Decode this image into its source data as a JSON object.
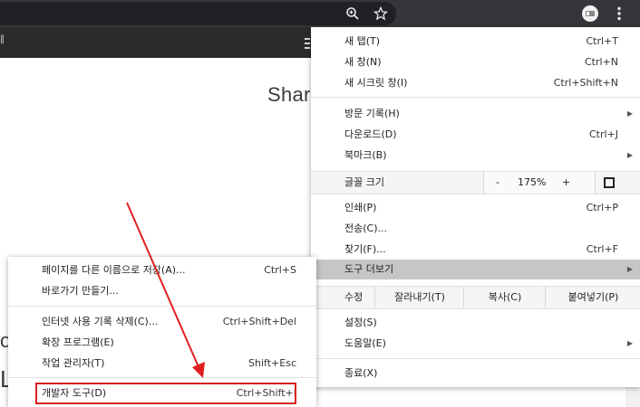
{
  "toolbar": {
    "zoom_icon": "zoom-in-icon",
    "star_icon": "star-icon",
    "extension_icon": "extension-icon",
    "menu_icon": "kebab-menu-icon"
  },
  "page": {
    "heading": "Shar",
    "fragment_1": "o",
    "fragment_2": "Ш",
    "bar_mark": "‖"
  },
  "menu": {
    "new_tab": {
      "label": "새 탭(T)",
      "shortcut": "Ctrl+T"
    },
    "new_window": {
      "label": "새 창(N)",
      "shortcut": "Ctrl+N"
    },
    "incognito": {
      "label": "새 시크릿 창(I)",
      "shortcut": "Ctrl+Shift+N"
    },
    "history": {
      "label": "방문 기록(H)"
    },
    "downloads": {
      "label": "다운로드(D)",
      "shortcut": "Ctrl+J"
    },
    "bookmarks": {
      "label": "북마크(B)"
    },
    "zoom": {
      "label": "글꼴 크기",
      "minus": "-",
      "value": "175%",
      "plus": "+"
    },
    "print": {
      "label": "인쇄(P)",
      "shortcut": "Ctrl+P"
    },
    "cast": {
      "label": "전송(C)..."
    },
    "find": {
      "label": "찾기(F)...",
      "shortcut": "Ctrl+F"
    },
    "more_tools": {
      "label": "도구 더보기"
    },
    "edit": {
      "label": "수정",
      "cut": "잘라내기(T)",
      "copy": "복사(C)",
      "paste": "붙여넣기(P)"
    },
    "settings": {
      "label": "설정(S)"
    },
    "help": {
      "label": "도움말(E)"
    },
    "exit": {
      "label": "종료(X)"
    }
  },
  "submenu": {
    "save_page": {
      "label": "페이지를 다른 이름으로 저장(A)...",
      "shortcut": "Ctrl+S"
    },
    "create_shortcut": {
      "label": "바로가기 만들기..."
    },
    "clear_history": {
      "label": "인터넷 사용 기록 삭제(C)...",
      "shortcut": "Ctrl+Shift+Del"
    },
    "extensions": {
      "label": "확장 프로그램(E)"
    },
    "task_manager": {
      "label": "작업 관리자(T)",
      "shortcut": "Shift+Esc"
    },
    "dev_tools": {
      "label": "개발자 도구(D)",
      "shortcut": "Ctrl+Shift+I"
    }
  },
  "colors": {
    "highlight": "#c6c6c6",
    "annotation_red": "#d82020",
    "chrome_dark": "#35363a"
  }
}
